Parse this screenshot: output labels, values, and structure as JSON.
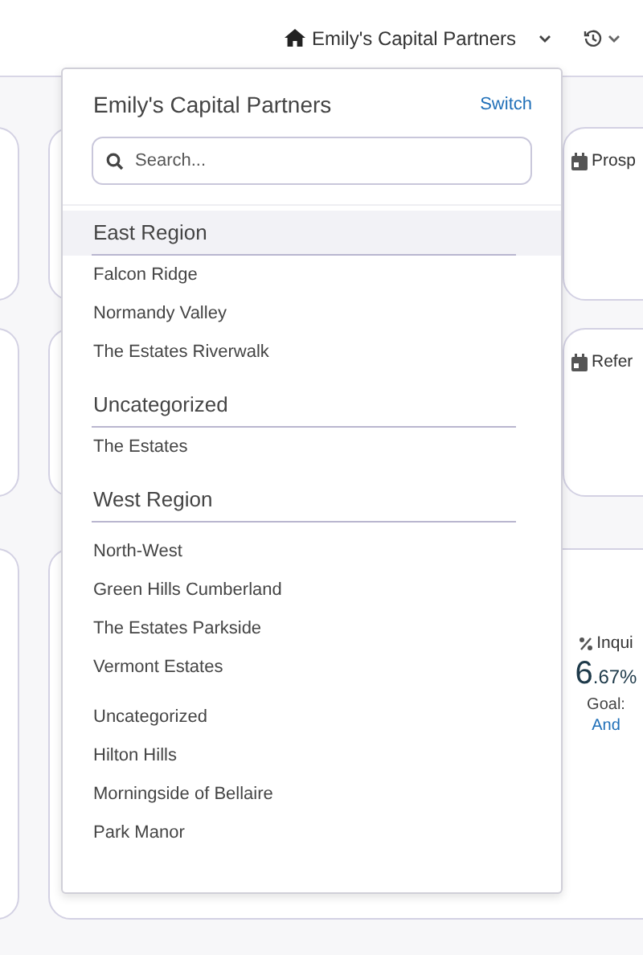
{
  "top_bar": {
    "account": "Emily's Capital Partners"
  },
  "background": {
    "cards": [
      {
        "title": "Prosp"
      },
      {
        "title": "Refer"
      }
    ],
    "stat": {
      "label": "Inqui",
      "whole": "6",
      "fraction": ".67%",
      "goal": "Goal:",
      "link": "And"
    }
  },
  "dropdown": {
    "title": "Emily's Capital Partners",
    "switch": "Switch",
    "search": {
      "placeholder": "Search..."
    },
    "groups": [
      {
        "heading": "East Region",
        "highlighted": true,
        "items": [
          {
            "kind": "item",
            "label": "Falcon Ridge"
          },
          {
            "kind": "item",
            "label": "Normandy Valley"
          },
          {
            "kind": "item",
            "label": "The Estates Riverwalk"
          }
        ]
      },
      {
        "heading": "Uncategorized",
        "highlighted": false,
        "items": [
          {
            "kind": "item",
            "label": "The Estates"
          }
        ]
      },
      {
        "heading": "West Region",
        "highlighted": false,
        "items": [
          {
            "kind": "item",
            "label": "North-West"
          },
          {
            "kind": "item",
            "label": "Green Hills Cumberland"
          },
          {
            "kind": "item",
            "label": "The Estates Parkside"
          },
          {
            "kind": "item",
            "label": "Vermont Estates"
          },
          {
            "kind": "subheading",
            "label": "Uncategorized"
          },
          {
            "kind": "item",
            "label": "Hilton Hills"
          },
          {
            "kind": "item",
            "label": "Morningside of Bellaire"
          },
          {
            "kind": "item",
            "label": "Park Manor"
          }
        ]
      }
    ]
  }
}
